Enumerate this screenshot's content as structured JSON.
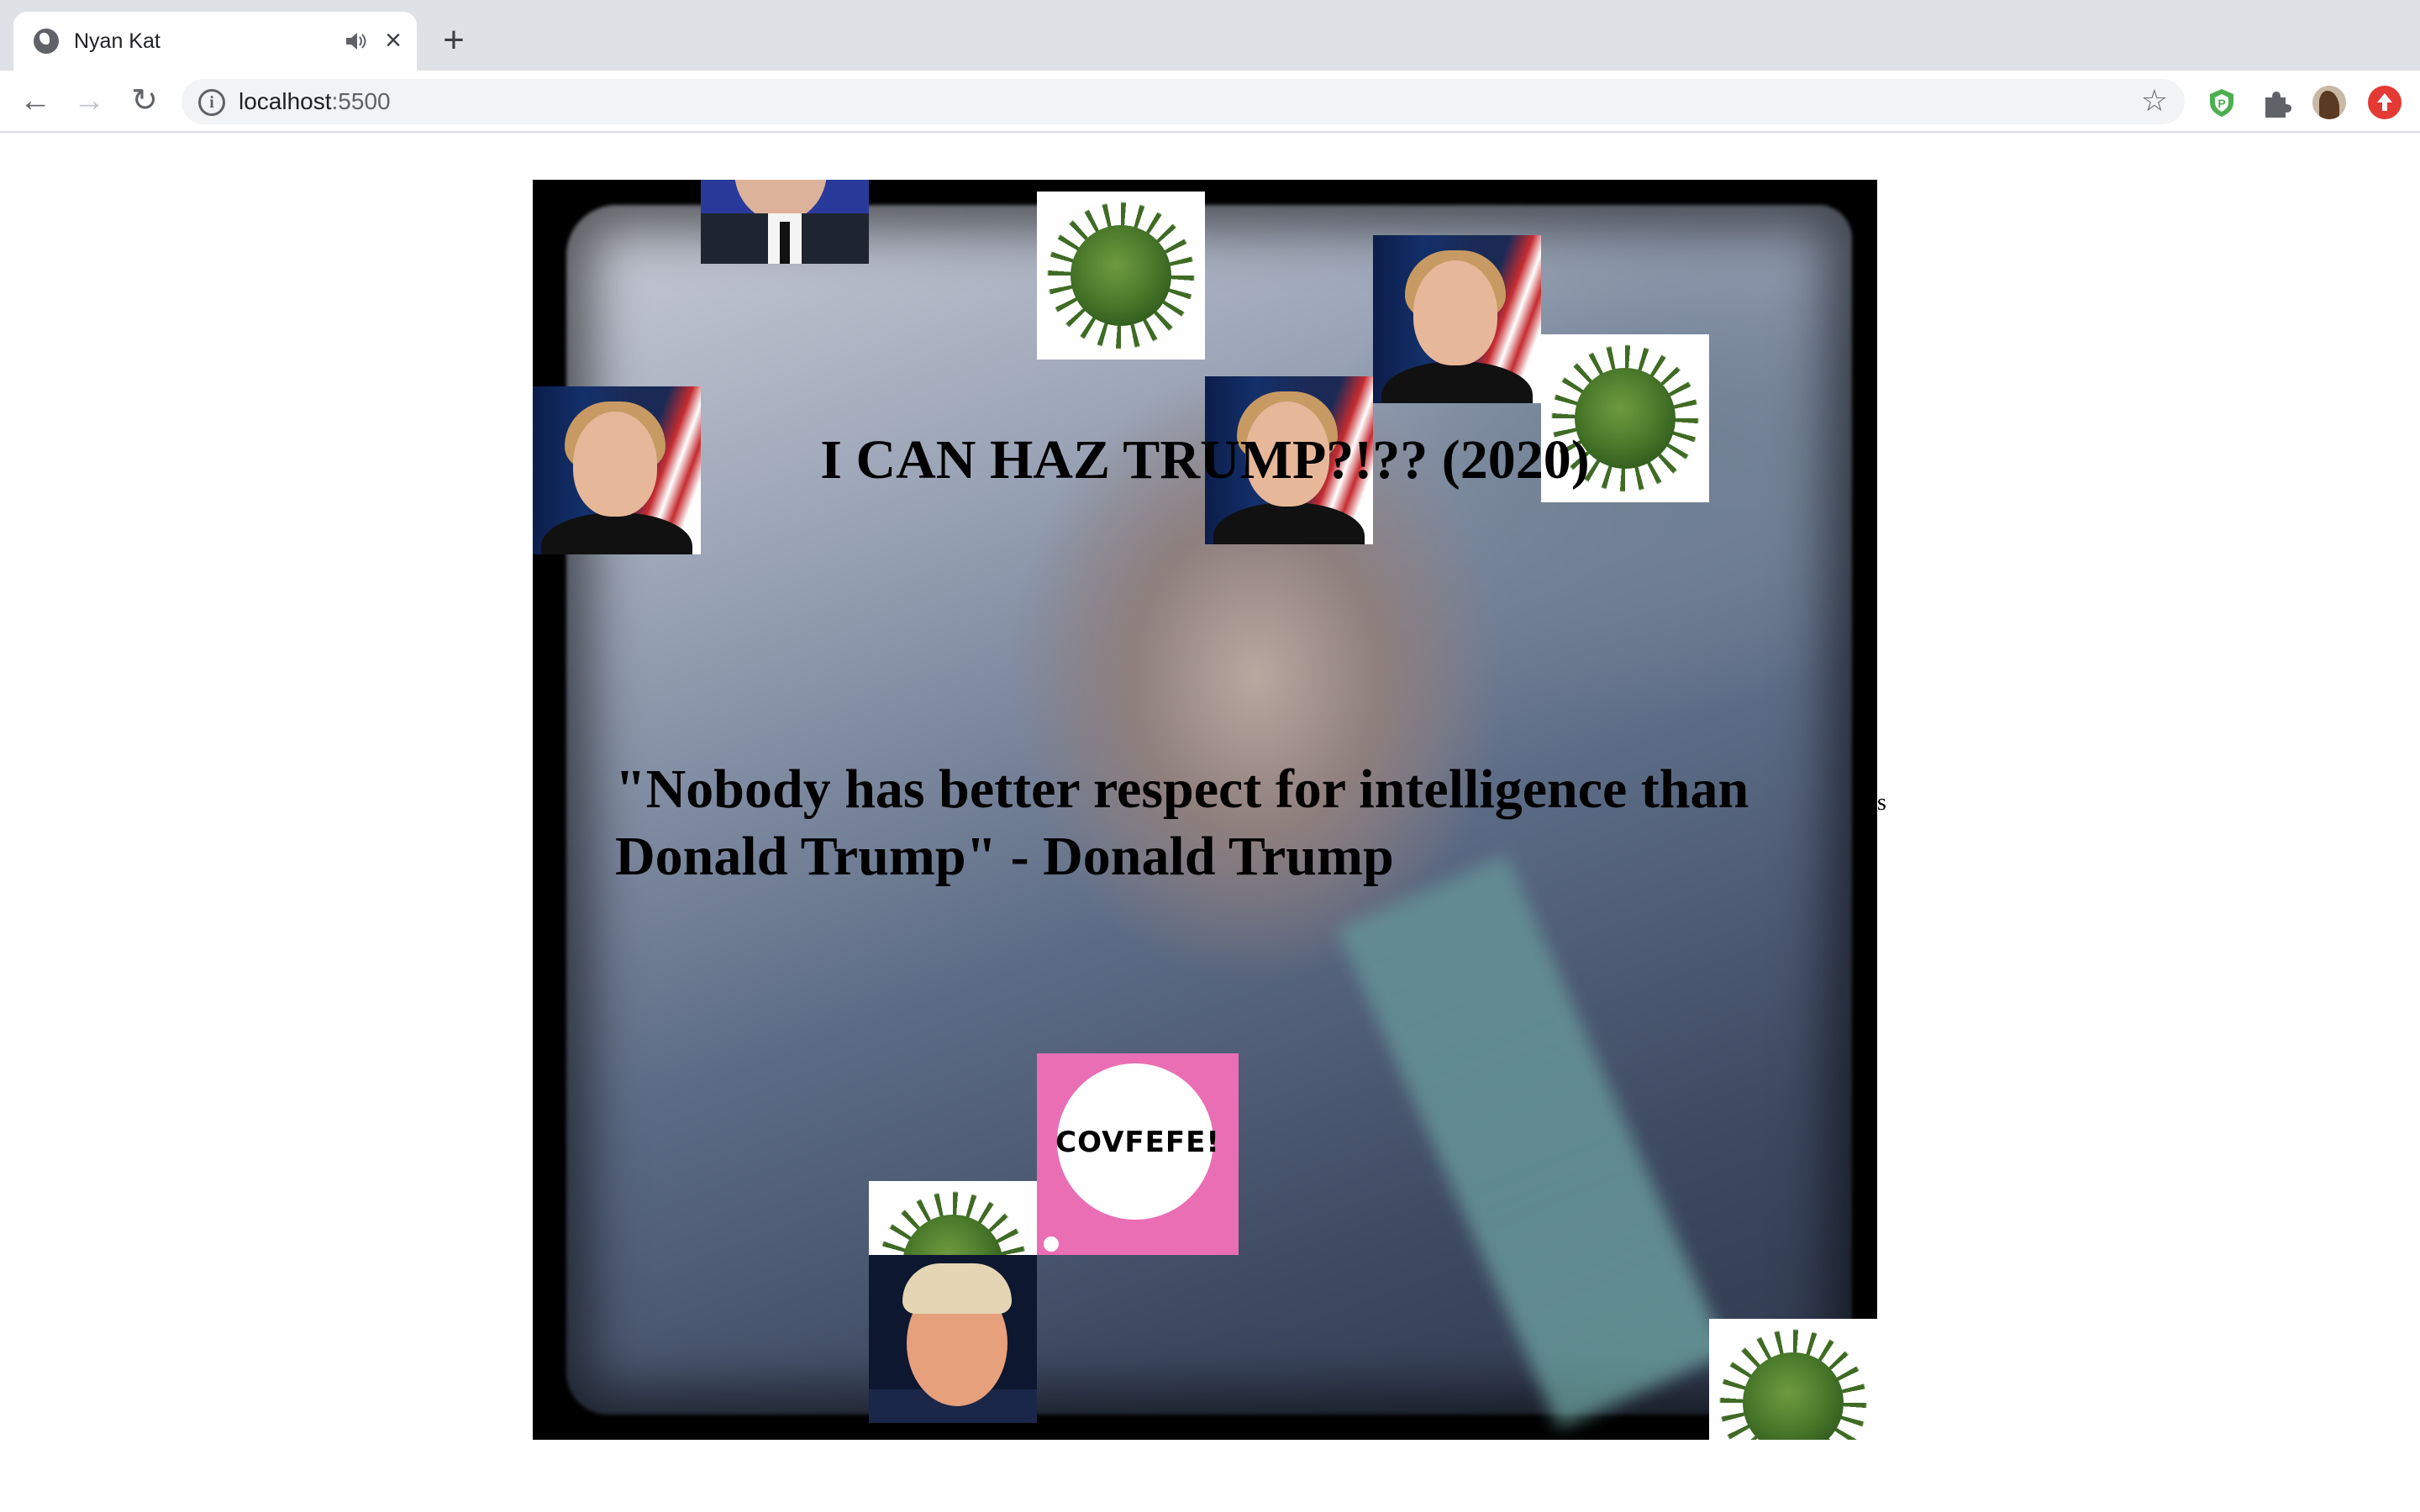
{
  "browser": {
    "tab_title": "Nyan Kat",
    "tab_close": "×",
    "new_tab": "+",
    "url_host": "localhost",
    "url_port": ":5500",
    "back": "←",
    "forward": "→",
    "reload": "↻",
    "star": "☆"
  },
  "page": {
    "title": "I CAN HAZ TRUMP?!?? (2020)",
    "quote": "\"Nobody has better respect for intelligence than Donald Trump\" - Donald Trump",
    "stray_text": "s",
    "covfefe_label": "COVFEFE!"
  },
  "colors": {
    "covfefe_bg": "#ea6eb4",
    "tabstrip": "#dee1e6"
  }
}
